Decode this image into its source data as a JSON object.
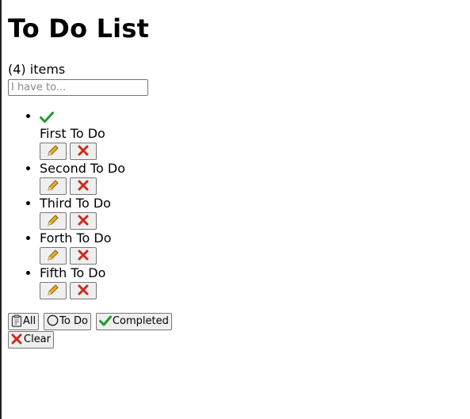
{
  "page": {
    "title": "To Do List",
    "count_text": "(4) items",
    "input_placeholder": "I have to..."
  },
  "todos": [
    {
      "label": "First To Do",
      "completed": true
    },
    {
      "label": "Second To Do",
      "completed": false
    },
    {
      "label": "Third To Do",
      "completed": false
    },
    {
      "label": "Forth To Do",
      "completed": false
    },
    {
      "label": "Fifth To Do",
      "completed": false
    }
  ],
  "filters": {
    "all": "All",
    "todo": "To Do",
    "completed": "Completed",
    "clear": "Clear"
  },
  "icons": {
    "check": "check-icon",
    "edit": "pencil-icon",
    "delete": "x-icon",
    "all": "clipboard-icon",
    "todo": "circle-icon",
    "clear": "x-icon"
  },
  "colors": {
    "check_green": "#1e9a2e",
    "delete_red": "#cc2a1a",
    "pencil_yellow": "#e8b020"
  }
}
